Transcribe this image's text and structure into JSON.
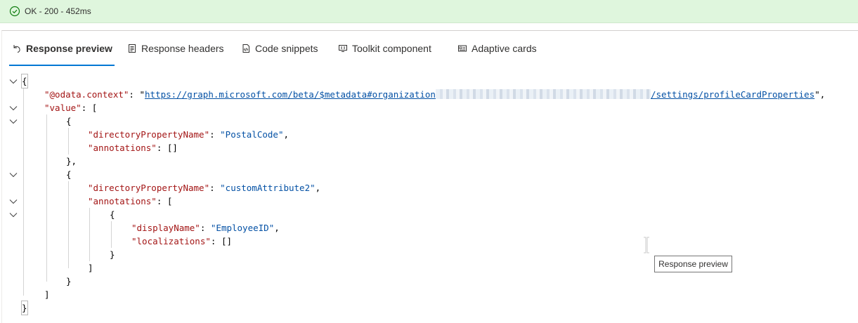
{
  "status": {
    "text": "OK - 200 - 452ms",
    "color": "#dff6dd",
    "icon": "check-circle-icon"
  },
  "tabs": [
    {
      "label": "Response preview",
      "icon": "undo-arrow-icon",
      "active": true
    },
    {
      "label": "Response headers",
      "icon": "document-icon",
      "active": false
    },
    {
      "label": "Code snippets",
      "icon": "code-file-icon",
      "active": false
    },
    {
      "label": "Toolkit component",
      "icon": "toolkit-icon",
      "active": false
    },
    {
      "label": "Adaptive cards",
      "icon": "card-icon",
      "active": false
    }
  ],
  "json": {
    "open_brace": "{",
    "close_brace": "}",
    "context_key": "\"@odata.context\"",
    "context_url_prefix": "https://graph.microsoft.com/beta/$metadata#organization",
    "context_url_suffix": "/settings/profileCardProperties",
    "value_key": "\"value\"",
    "item1": {
      "dpn_key": "\"directoryPropertyName\"",
      "dpn_value": "\"PostalCode\"",
      "ann_key": "\"annotations\"",
      "ann_value": "[]"
    },
    "item2": {
      "dpn_key": "\"directoryPropertyName\"",
      "dpn_value": "\"customAttribute2\"",
      "ann_key": "\"annotations\""
    },
    "annotation": {
      "display_key": "\"displayName\"",
      "display_value": "\"EmployeeID\"",
      "loc_key": "\"localizations\"",
      "loc_value": "[]"
    }
  },
  "tooltip": {
    "text": "Response preview"
  },
  "colors": {
    "accent": "#0078d4",
    "key": "#a31515",
    "string": "#0451a5"
  }
}
